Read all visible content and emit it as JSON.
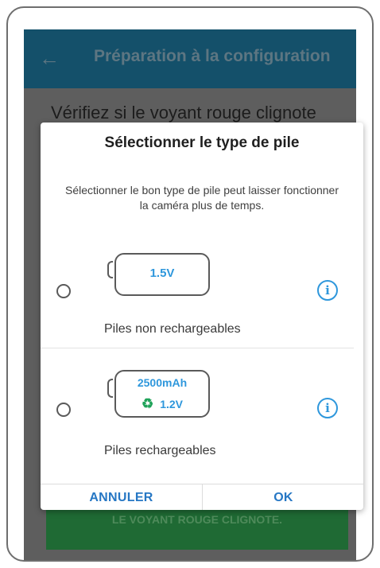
{
  "app_bar": {
    "title": "Préparation à la configuration",
    "back_icon": "arrow-left-icon"
  },
  "background": {
    "instruction_text": "Vérifiez si le voyant rouge clignote",
    "green_button_label": "LE VOYANT ROUGE CLIGNOTE."
  },
  "dialog": {
    "title": "Sélectionner le type de pile",
    "description": "Sélectionner le bon type de pile peut laisser fonctionner la caméra plus de temps.",
    "options": [
      {
        "battery_voltage": "1.5V",
        "label": "Piles non rechargeables",
        "selected": false,
        "info_icon": "info-icon"
      },
      {
        "battery_capacity": "2500mAh",
        "battery_voltage": "1.2V",
        "recycle_icon": "recycle-icon",
        "label": "Piles rechargeables",
        "selected": false,
        "info_icon": "info-icon"
      }
    ],
    "cancel_label": "ANNULER",
    "ok_label": "OK"
  },
  "colors": {
    "app_bar": "#14506a",
    "accent_blue": "#2e97dc",
    "button_blue": "#2677c4",
    "recycle_green": "#21a35a",
    "background_button_green": "#1f6a34"
  }
}
